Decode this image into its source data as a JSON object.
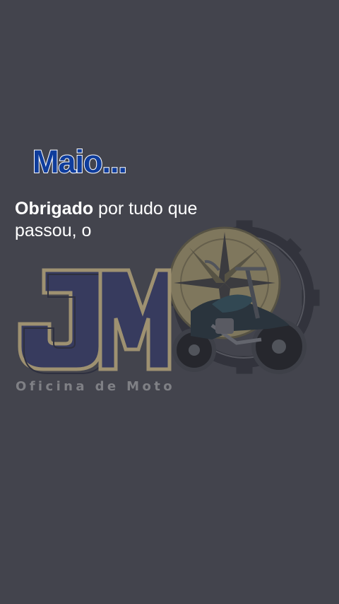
{
  "caption": {
    "title": "Maio...",
    "body_bold": "Obrigado",
    "body_rest": " por tudo que passou, o"
  },
  "logo": {
    "letters": "JM",
    "tagline": "Oficina de Moto",
    "icons": [
      "gear-icon",
      "compass-rose-icon",
      "motorcycle-icon"
    ]
  },
  "colors": {
    "background": "#43444d",
    "caption_title": "#0f3d9c",
    "caption_body": "#ffffff",
    "logo_letters": "#3a3f6a",
    "logo_gold": "#b5a57a"
  }
}
